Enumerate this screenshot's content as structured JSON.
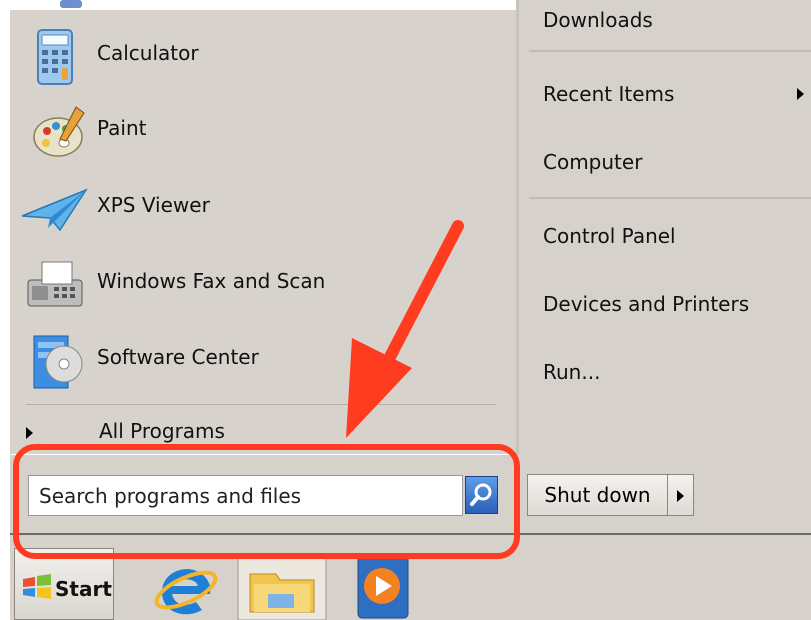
{
  "start_menu": {
    "programs": [
      {
        "label": "Calculator",
        "icon": "calculator-icon"
      },
      {
        "label": "Paint",
        "icon": "paint-icon"
      },
      {
        "label": "XPS Viewer",
        "icon": "xps-viewer-icon"
      },
      {
        "label": "Windows Fax and Scan",
        "icon": "fax-scan-icon"
      },
      {
        "label": "Software Center",
        "icon": "software-center-icon"
      }
    ],
    "all_programs_label": "All Programs",
    "places": [
      {
        "label": "Downloads"
      },
      {
        "label": "Recent Items",
        "has_submenu": true
      },
      {
        "label": "Computer"
      },
      {
        "label": "Control Panel"
      },
      {
        "label": "Devices and Printers"
      },
      {
        "label": "Run..."
      }
    ],
    "search": {
      "placeholder": "Search programs and files"
    },
    "shutdown_label": "Shut down"
  },
  "taskbar": {
    "start_label": "Start",
    "pinned": [
      "internet-explorer-icon",
      "file-explorer-icon",
      "media-player-icon"
    ]
  },
  "annotation": {
    "color": "#ff3c1f"
  },
  "colors": {
    "menu_bg": "#d6d2cb",
    "accent": "#2a5fb8"
  }
}
